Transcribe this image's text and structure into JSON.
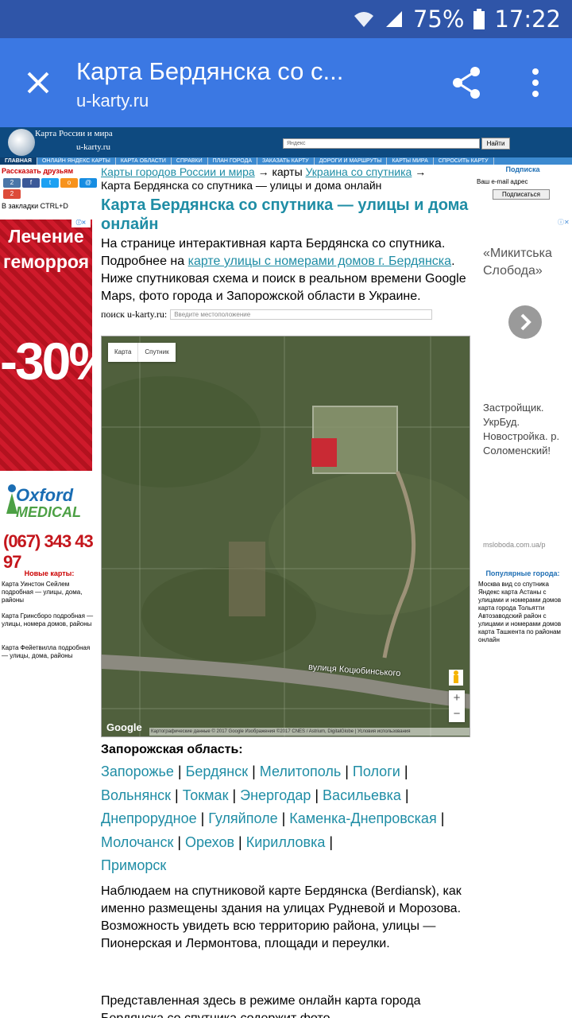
{
  "status_bar": {
    "battery": "75%",
    "time": "17:22"
  },
  "browser": {
    "title": "Карта Бердянска со с...",
    "url": "u-karty.ru"
  },
  "site": {
    "logo_line1": "Карта России и мира",
    "logo_line2": "u-karty.ru",
    "search_placeholder": "Яндекс",
    "search_button": "Найти",
    "nav": [
      "ГЛАВНАЯ",
      "ОНЛАЙН ЯНДЕКС КАРТЫ",
      "КАРТА ОБЛАСТИ",
      "СПРАВКИ",
      "ПЛАН ГОРОДА",
      "ЗАКАЗАТЬ КАРТУ",
      "ДОРОГИ И МАРШРУТЫ",
      "КАРТЫ МИРА",
      "СПРОСИТЬ КАРТУ"
    ]
  },
  "left": {
    "share_title": "Рассказать друзьям",
    "social_counts": {
      "vk": "2",
      "gplus": "2"
    },
    "bookmark": "В закладки CTRL+D",
    "ad": {
      "line1": "Лечение",
      "line2": "геморроя",
      "discount": "-30%"
    },
    "oxford": {
      "brand1": "Oxford",
      "brand2": "MEDICAL",
      "phone": "(067) 343 43 97"
    },
    "new_maps_title": "Новые карты:",
    "new_maps": [
      "Карта Уинстон Сейлем подробная — улицы, дома, районы",
      "Карта Гринсборо подробная — улицы, номера домов, районы",
      "Карта Фейетвилла подробная — улицы, дома, районы"
    ]
  },
  "main": {
    "crumb1": "Карты городов России и мира",
    "crumb_sep1": " → карты ",
    "crumb2": "Украина со спутника",
    "crumb_sep2": " →",
    "crumb3": "Карта Бердянска со спутника — улицы и дома онлайн",
    "h1": "Карта Бердянска со спутника — улицы и дома онлайн",
    "intro_a": "На странице интерактивная карта Бердянска со спутника. Подробнее на ",
    "intro_link": "карте улицы с номерами домов г. Бердянска",
    "intro_b": ". Ниже спутниковая схема и поиск в реальном времени Google Maps, фото города и Запорожской области в Украине.",
    "place_label": "поиск u-karty.ru:",
    "place_placeholder": "Введите местоположение",
    "map": {
      "type_map": "Карта",
      "type_sat": "Спутник",
      "road_label": "вулиця Коцюбинського",
      "google": "Google",
      "attribution": "Картографические данные © 2017 Google Изображения ©2017 CNES / Astrium, DigitalGlobe | Условия использования",
      "zoom_in": "+",
      "zoom_out": "−"
    },
    "region_title": "Запорожская область:",
    "cities": [
      "Запорожье",
      "Бердянск",
      "Мелитополь",
      "Пологи",
      "Вольнянск",
      "Токмак",
      "Энергодар",
      "Васильевка",
      "Днепрорудное",
      "Гуляйполе",
      "Каменка-Днепровская",
      "Молочанск",
      "Орехов",
      "Кирилловка",
      "Приморск"
    ],
    "para1": "Наблюдаем на спутниковой карте Бердянска (Berdiansk), как именно размещены здания на улицах Рудневой и Морозова. Возможность увидеть всю территорию района, улицы — Пионерская и Лермонтова, площади и переулки.",
    "para2": "Представленная здесь в режиме онлайн карта города Бердянска со спутника содержит фото"
  },
  "right": {
    "subscribe_title": "Подписка",
    "email_label": "Ваш e-mail адрес",
    "subscribe_button": "Подписаться",
    "ad_title": "«Микитська Слобода»",
    "ad_text": "Застройщик. УкрБуд. Новостройка. р. Соломенский!",
    "ad_source": "mslobodа.com.ua/p",
    "popular_title": "Популярные города:",
    "popular": [
      "Москва вид со спутника",
      "Яндекс карта Астаны с улицами и номерами домов",
      "карта города Тольятти Автозаводский район с улицами и номерами домов",
      "карта Ташкента по районам онлайн"
    ]
  }
}
